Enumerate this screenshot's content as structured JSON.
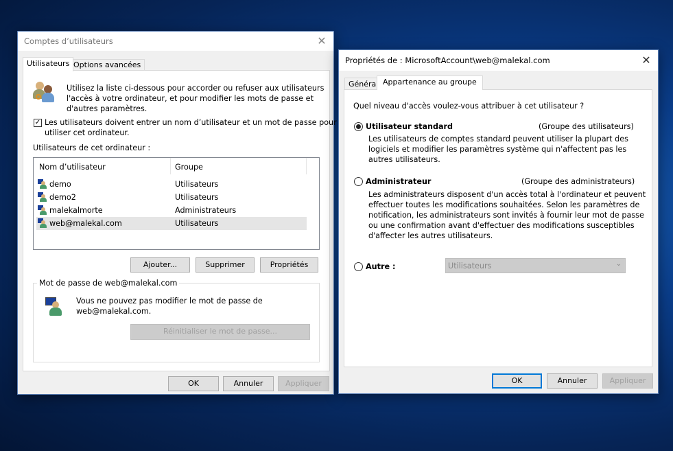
{
  "accounts_dialog": {
    "title": "Comptes d’utilisateurs",
    "tabs": [
      {
        "label": "Utilisateurs"
      },
      {
        "label": "Options avancées"
      }
    ],
    "intro": [
      "Utilisez la liste ci-dessous pour accorder ou refuser aux utilisateurs",
      "l'accès à votre ordinateur, et pour modifier les mots de passe et",
      "d'autres paramètres."
    ],
    "require_login": {
      "checked": true,
      "lines": [
        "Les utilisateurs doivent entrer un nom d’utilisateur et un mot de passe pour",
        "utiliser cet ordinateur."
      ]
    },
    "users_label": "Utilisateurs de cet ordinateur :",
    "columns": [
      "Nom d’utilisateur",
      "Groupe"
    ],
    "rows": [
      {
        "name": "demo",
        "group": "Utilisateurs"
      },
      {
        "name": "demo2",
        "group": "Utilisateurs"
      },
      {
        "name": "malekalmorte",
        "group": "Administrateurs"
      },
      {
        "name": "web@malekal.com",
        "group": "Utilisateurs",
        "selected": true
      }
    ],
    "buttons": {
      "add": "Ajouter...",
      "remove": "Supprimer",
      "properties": "Propriétés"
    },
    "password_group": {
      "title": "Mot de passe de web@malekal.com",
      "lines": [
        "Vous ne pouvez pas modifier le mot de passe de",
        "web@malekal.com."
      ],
      "reset": "Réinitialiser le mot de passe..."
    },
    "footer": {
      "ok": "OK",
      "cancel": "Annuler",
      "apply": "Appliquer"
    }
  },
  "props_dialog": {
    "title": "Propriétés de : MicrosoftAccount\\web@malekal.com",
    "tabs": [
      {
        "label": "Général"
      },
      {
        "label": "Appartenance au groupe"
      }
    ],
    "question": "Quel niveau d'accès voulez-vous attribuer à cet utilisateur ?",
    "standard": {
      "label": "Utilisateur standard",
      "group": "(Groupe des utilisateurs)",
      "selected": true,
      "desc": [
        "Les utilisateurs de comptes standard peuvent utiliser la plupart des",
        "logiciels et modifier les paramètres système qui n'affectent pas les",
        "autres utilisateurs."
      ]
    },
    "admin": {
      "label": "Administrateur",
      "group": "(Groupe des administrateurs)",
      "selected": false,
      "desc": [
        "Les administrateurs disposent d'un accès total à l'ordinateur et peuvent",
        "effectuer toutes les modifications souhaitées. Selon les paramètres de",
        "notification, les administrateurs sont invités à fournir leur mot de passe",
        "ou une confirmation avant d'effectuer des modifications susceptibles",
        "d'affecter les autres utilisateurs."
      ]
    },
    "other": {
      "label": "Autre :",
      "selected": false,
      "dropdown_value": "Utilisateurs"
    },
    "footer": {
      "ok": "OK",
      "cancel": "Annuler",
      "apply": "Appliquer"
    }
  }
}
